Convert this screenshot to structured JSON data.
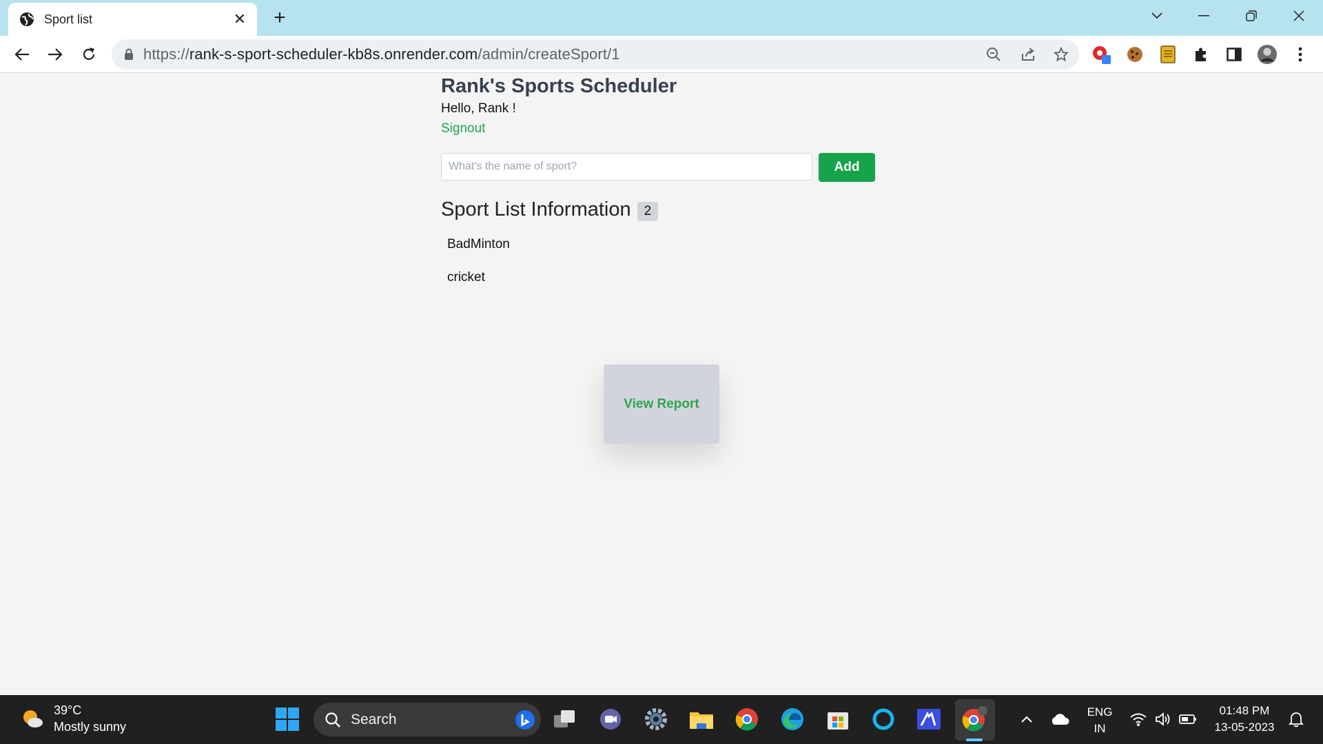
{
  "browser": {
    "tab_title": "Sport list",
    "url_scheme": "https://",
    "url_host": "rank-s-sport-scheduler-kb8s.onrender.com",
    "url_path": "/admin/createSport/1"
  },
  "app": {
    "title": "Rank's Sports Scheduler",
    "greeting": "Hello, Rank !",
    "signout_label": "Signout"
  },
  "form": {
    "sport_placeholder": "What's the name of sport?",
    "sport_value": "",
    "add_label": "Add"
  },
  "sport_list": {
    "heading": "Sport List Information",
    "count": "2",
    "items": [
      "BadMinton",
      "cricket"
    ]
  },
  "report": {
    "label": "View Report"
  },
  "taskbar": {
    "weather_temp": "39°C",
    "weather_desc": "Mostly sunny",
    "search_label": "Search",
    "lang": "ENG",
    "region": "IN",
    "time": "01:48 PM",
    "date": "13-05-2023"
  },
  "colors": {
    "accent_green": "#16a34a",
    "link_green": "#22a34a",
    "tabstrip": "#b6e3ef",
    "taskbar": "#202020"
  }
}
